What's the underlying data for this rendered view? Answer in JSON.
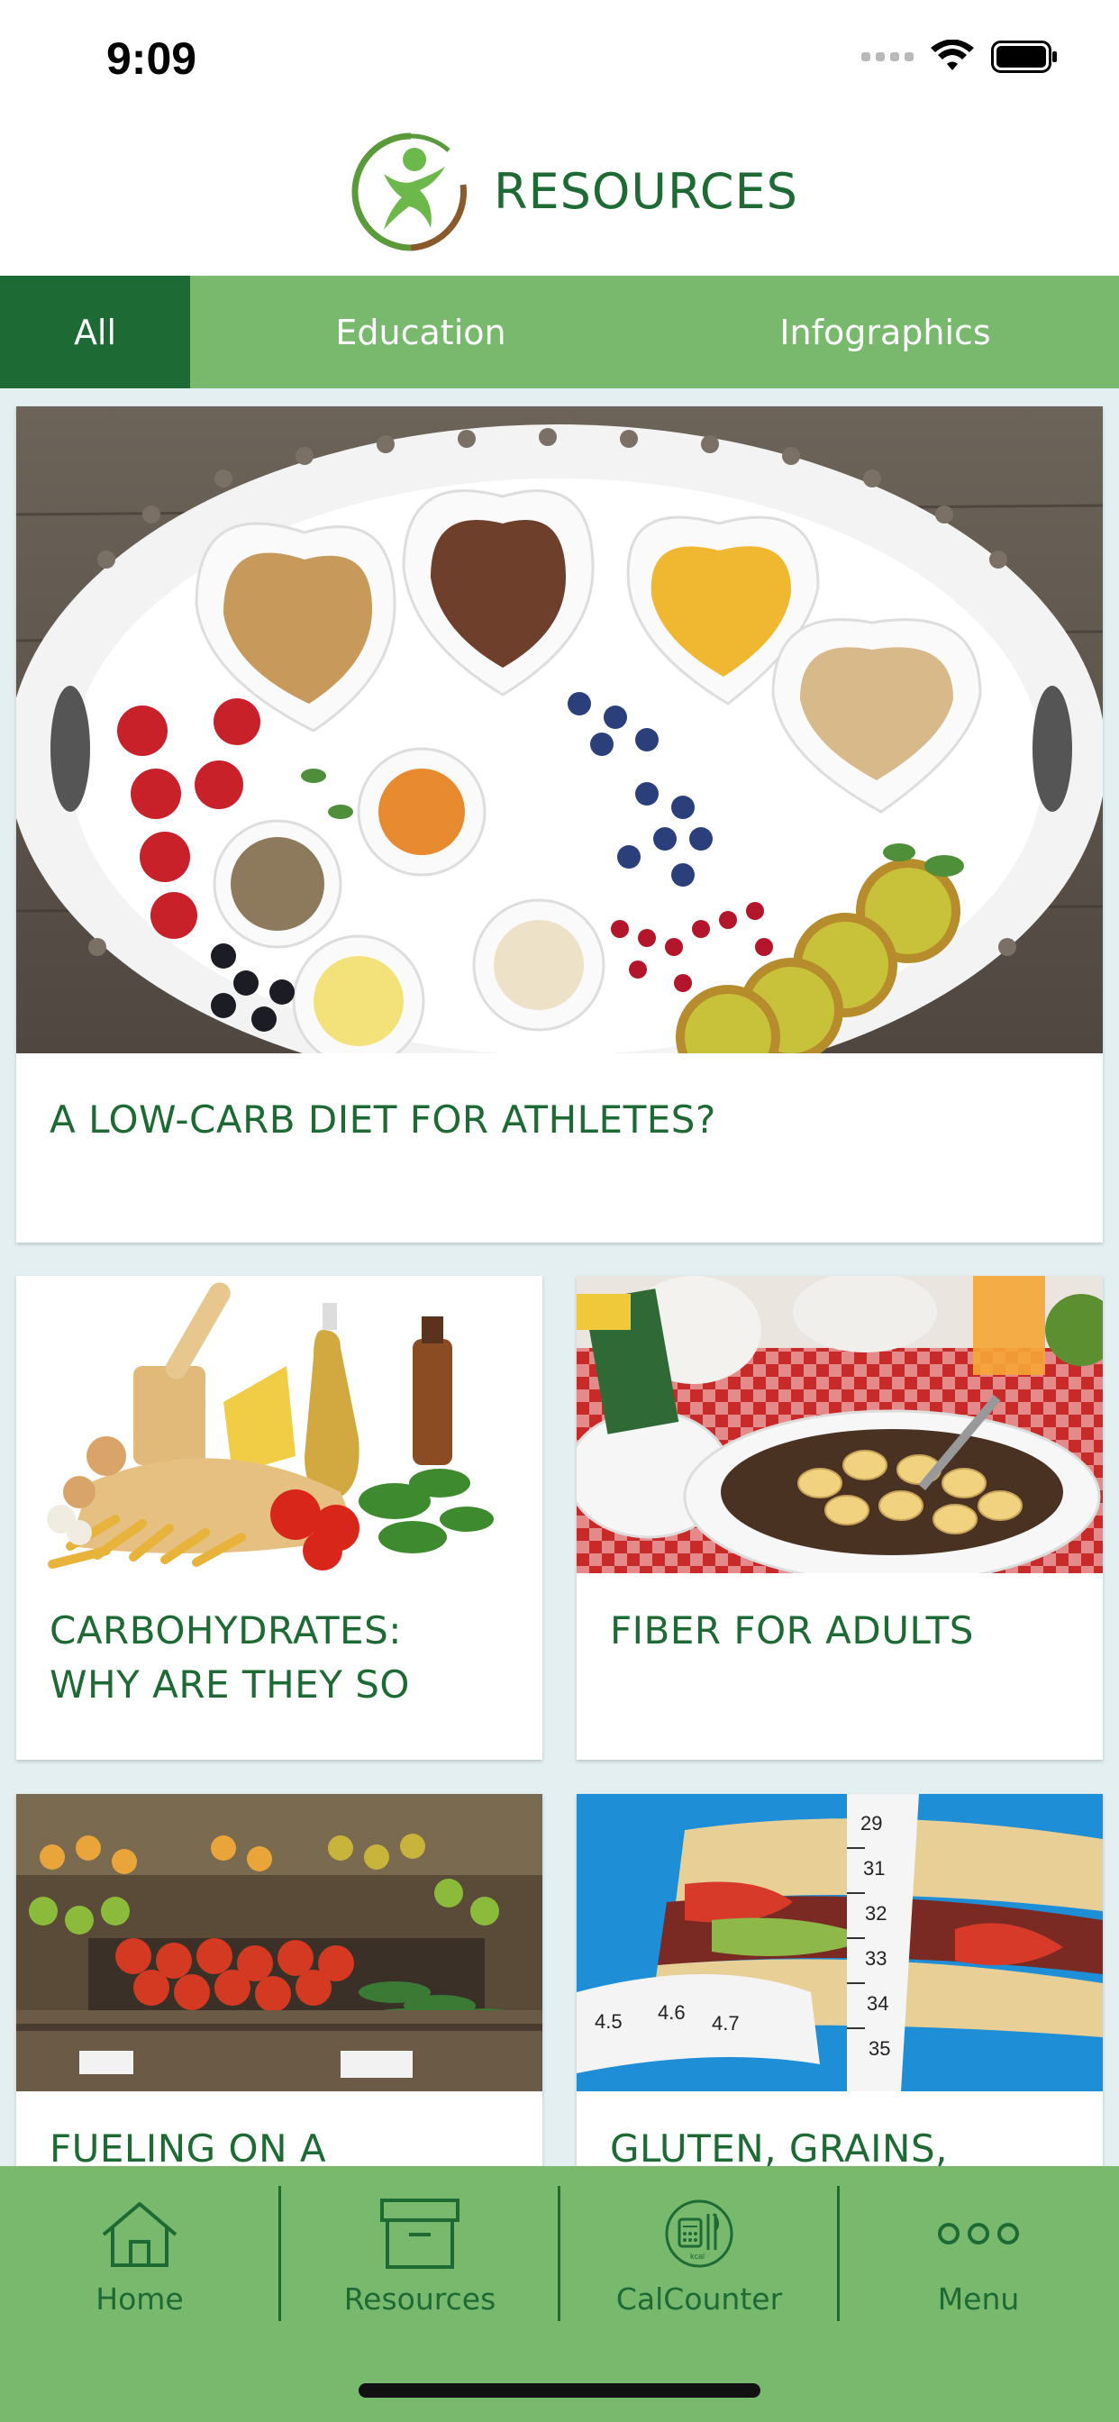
{
  "status_bar": {
    "time": "9:09"
  },
  "header": {
    "title": "RESOURCES",
    "logo_icon": "person-logo-icon"
  },
  "tabs": [
    {
      "label": "All",
      "active": true
    },
    {
      "label": "Education",
      "active": false
    },
    {
      "label": "Infographics",
      "active": false
    }
  ],
  "cards": [
    {
      "title": "A LOW-CARB DIET FOR ATHLETES?",
      "image": "breakfast-tray-photo"
    },
    {
      "title_line1": "CARBOHYDRATES:",
      "title_line2": "WHY ARE THEY SO",
      "image": "pasta-ingredients-photo"
    },
    {
      "title": "FIBER FOR ADULTS",
      "image": "cereal-bowl-photo"
    },
    {
      "title": "FUELING ON A",
      "image": "produce-market-photo"
    },
    {
      "title": "GLUTEN, GRAINS,",
      "image": "sandwich-tape-measure-photo"
    }
  ],
  "bottom_nav": [
    {
      "label": "Home",
      "icon": "home-icon"
    },
    {
      "label": "Resources",
      "icon": "box-icon"
    },
    {
      "label": "CalCounter",
      "icon": "calculator-icon"
    },
    {
      "label": "Menu",
      "icon": "more-icon"
    }
  ],
  "colors": {
    "primary_dark": "#1d6a35",
    "primary_light": "#78b96d",
    "background": "#e3eff1"
  }
}
